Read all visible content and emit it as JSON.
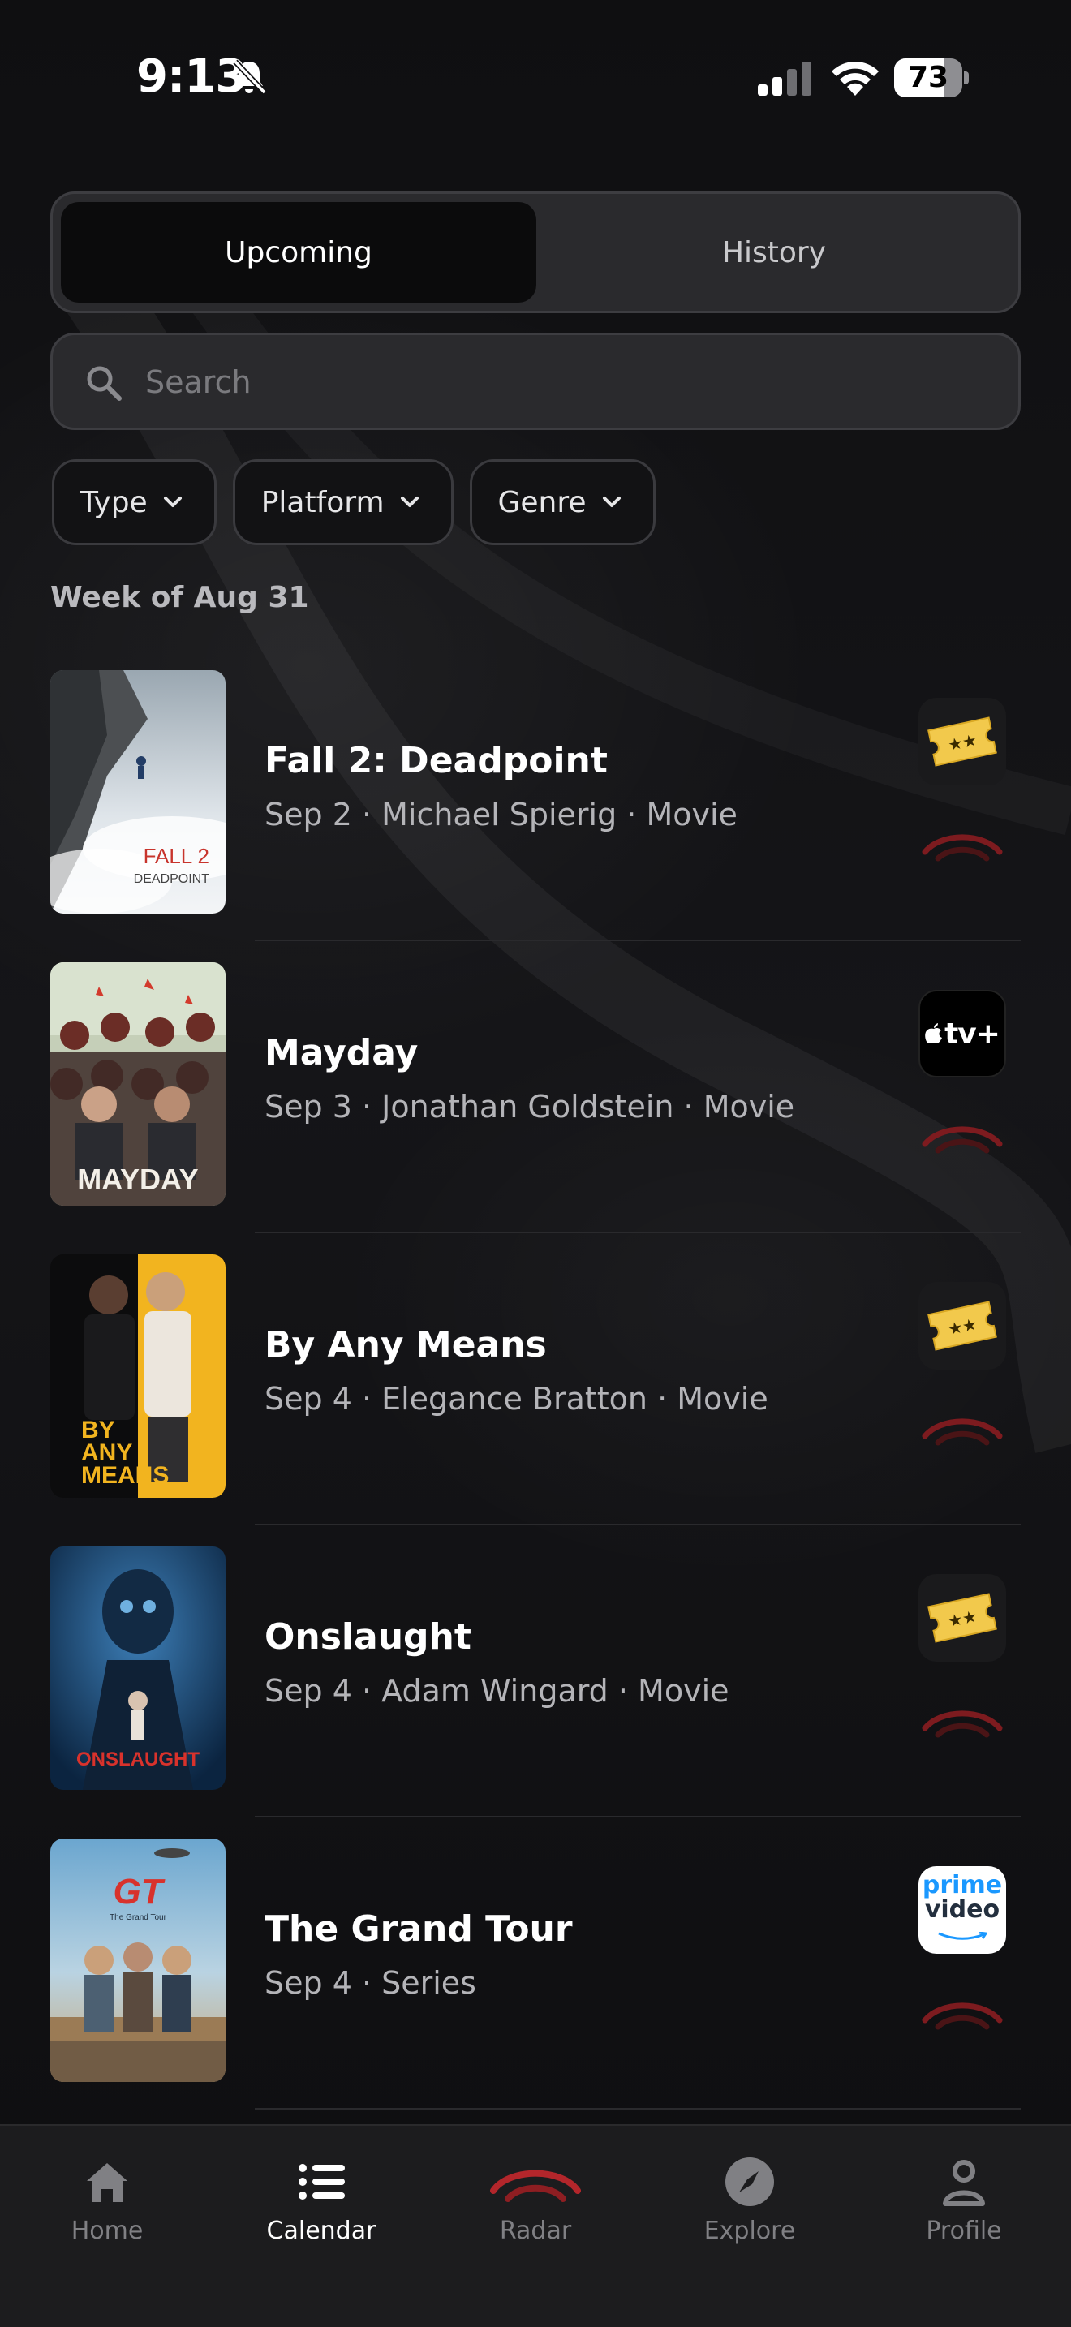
{
  "status_bar": {
    "time": "9:13",
    "battery": "73",
    "battery_level": 0.73
  },
  "segmented": {
    "upcoming": "Upcoming",
    "history": "History",
    "active": "Upcoming"
  },
  "search": {
    "placeholder": "Search",
    "value": ""
  },
  "filters": [
    "Type",
    "Platform",
    "Genre"
  ],
  "week_label": "Week of Aug 31",
  "items": [
    {
      "title": "Fall 2: Deadpoint",
      "meta": "Sep 2 · Michael Spierig · Movie",
      "platform": "ticket-icon",
      "poster_text": [
        "FALL 2",
        "DEADPOINT"
      ]
    },
    {
      "title": "Mayday",
      "meta": "Sep 3 · Jonathan Goldstein · Movie",
      "platform": "apple-tv-icon",
      "platform_label": "tv+",
      "poster_text": [
        "MAYDAY"
      ]
    },
    {
      "title": "By Any Means",
      "meta": "Sep 4 · Elegance Bratton · Movie",
      "platform": "ticket-icon",
      "poster_text": [
        "BY",
        "ANY",
        "MEANS"
      ]
    },
    {
      "title": "Onslaught",
      "meta": "Sep 4 · Adam Wingard · Movie",
      "platform": "ticket-icon",
      "poster_text": [
        "ONSLAUGHT"
      ]
    },
    {
      "title": "The Grand Tour",
      "meta": "Sep 4 · Series",
      "platform": "prime-video-icon",
      "platform_label": [
        "prime",
        "video"
      ],
      "poster_text": [
        "GT",
        "The Grand Tour"
      ]
    }
  ],
  "tabs": [
    {
      "label": "Home",
      "icon": "home-icon"
    },
    {
      "label": "Calendar",
      "icon": "list-icon",
      "active": true
    },
    {
      "label": "Radar",
      "icon": "radar-icon"
    },
    {
      "label": "Explore",
      "icon": "compass-icon"
    },
    {
      "label": "Profile",
      "icon": "person-icon"
    }
  ],
  "colors": {
    "accent_red": "#b3262b",
    "ticket_gold": "#f2c94c",
    "background": "#101012"
  }
}
